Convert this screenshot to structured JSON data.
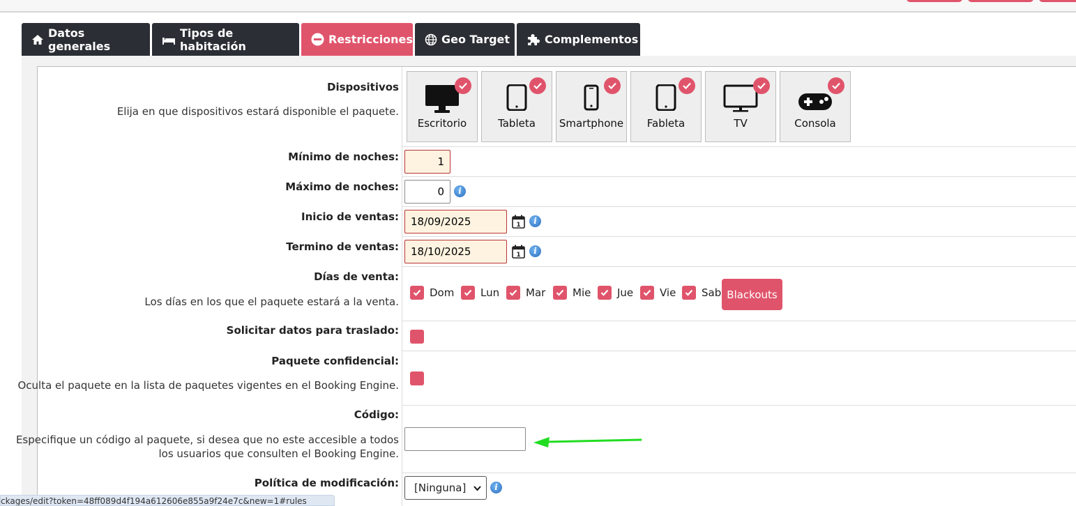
{
  "tabs": [
    {
      "label": "Datos generales",
      "icon": "home-icon",
      "active": false
    },
    {
      "label": "Tipos de habitación",
      "icon": "bed-icon",
      "active": false
    },
    {
      "label": "Restricciones",
      "icon": "minus-circle-icon",
      "active": true
    },
    {
      "label": "Geo Target",
      "icon": "globe-icon",
      "active": false
    },
    {
      "label": "Complementos",
      "icon": "puzzle-icon",
      "active": false
    }
  ],
  "dispositivos": {
    "label": "Dispositivos",
    "description": "Elija en que dispositivos estará disponible el paquete.",
    "devices": [
      {
        "label": "Escritorio",
        "icon": "desktop-icon",
        "checked": true
      },
      {
        "label": "Tableta",
        "icon": "tablet-icon",
        "checked": true
      },
      {
        "label": "Smartphone",
        "icon": "smartphone-icon",
        "checked": true
      },
      {
        "label": "Fableta",
        "icon": "phablet-icon",
        "checked": true
      },
      {
        "label": "TV",
        "icon": "tv-icon",
        "checked": true
      },
      {
        "label": "Consola",
        "icon": "gamepad-icon",
        "checked": true
      }
    ]
  },
  "min_noches": {
    "label": "Mínimo de noches:",
    "value": "1"
  },
  "max_noches": {
    "label": "Máximo de noches:",
    "value": "0"
  },
  "inicio_ventas": {
    "label": "Inicio de ventas:",
    "value": "18/09/2025"
  },
  "termino_ventas": {
    "label": "Termino de ventas:",
    "value": "18/10/2025"
  },
  "dias_venta": {
    "label": "Días de venta:",
    "description": "Los días en los que el paquete estará a la venta.",
    "days": [
      "Dom",
      "Lun",
      "Mar",
      "Mie",
      "Jue",
      "Vie",
      "Sab"
    ],
    "blackouts_label": "Blackouts"
  },
  "traslado": {
    "label": "Solicitar datos para traslado:"
  },
  "confidencial": {
    "label": "Paquete confidencial:",
    "description": "Oculta el paquete en la lista de paquetes vigentes en el Booking Engine."
  },
  "codigo": {
    "label": "Código:",
    "description_line1": "Especifique un código al paquete, si desea que no este accesible a todos",
    "description_line2": "los usuarios que consulten el Booking Engine.",
    "value": ""
  },
  "politica": {
    "label": "Política de modificación:",
    "selected": "[Ninguna]"
  },
  "status_url": "ckages/edit?token=48ff089d4f194a612606e855a9f24e7c&new=1#rules",
  "colors": {
    "accent": "#e0546b",
    "tab_dark": "#2b2f35",
    "arrow": "#22dd22"
  }
}
